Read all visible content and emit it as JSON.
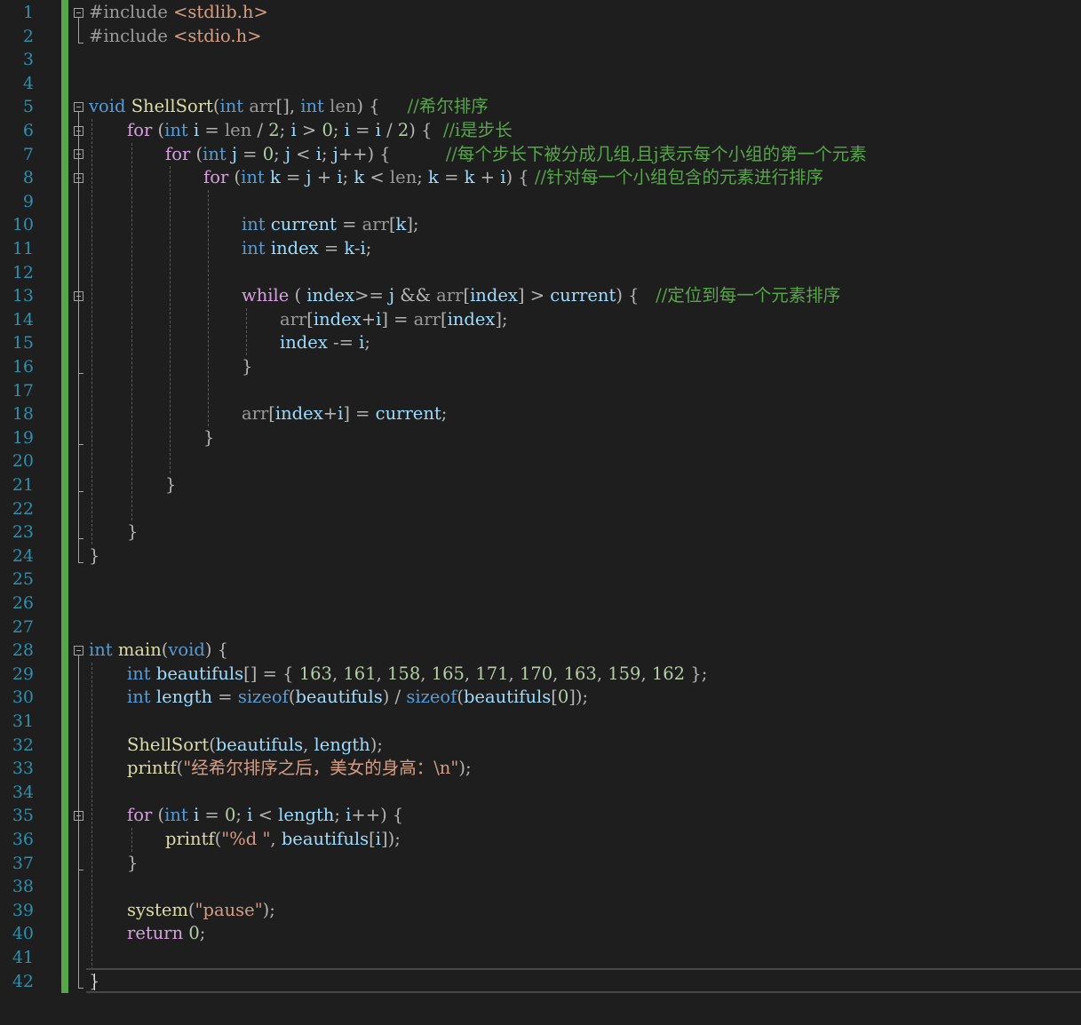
{
  "editor": {
    "line_count": 42,
    "current_line": 42
  },
  "lines": [
    {
      "n": 1,
      "indent": 0,
      "fold": true,
      "tokens": [
        [
          "pp",
          "#include "
        ],
        [
          "inc",
          "<stdlib.h>"
        ]
      ]
    },
    {
      "n": 2,
      "indent": 0,
      "tokens": [
        [
          "pp",
          "#include "
        ],
        [
          "inc",
          "<stdio.h>"
        ]
      ]
    },
    {
      "n": 3,
      "indent": 0,
      "tokens": []
    },
    {
      "n": 4,
      "indent": 0,
      "tokens": []
    },
    {
      "n": 5,
      "indent": 0,
      "fold": true,
      "tokens": [
        [
          "kw",
          "void"
        ],
        [
          "txt",
          " "
        ],
        [
          "fn",
          "ShellSort"
        ],
        [
          "punc",
          "("
        ],
        [
          "kw",
          "int"
        ],
        [
          "txt",
          " "
        ],
        [
          "param",
          "arr"
        ],
        [
          "punc",
          "[], "
        ],
        [
          "kw",
          "int"
        ],
        [
          "txt",
          " "
        ],
        [
          "param",
          "len"
        ],
        [
          "punc",
          ") {"
        ],
        [
          "txt",
          "     "
        ],
        [
          "cmt",
          "//希尔排序"
        ]
      ]
    },
    {
      "n": 6,
      "indent": 1,
      "fold": true,
      "tokens": [
        [
          "ctrl",
          "for"
        ],
        [
          "txt",
          " "
        ],
        [
          "punc",
          "("
        ],
        [
          "kw",
          "int"
        ],
        [
          "txt",
          " "
        ],
        [
          "var",
          "i"
        ],
        [
          "op",
          " = "
        ],
        [
          "param",
          "len"
        ],
        [
          "op",
          " / "
        ],
        [
          "num",
          "2"
        ],
        [
          "punc",
          "; "
        ],
        [
          "var",
          "i"
        ],
        [
          "op",
          " > "
        ],
        [
          "num",
          "0"
        ],
        [
          "punc",
          "; "
        ],
        [
          "var",
          "i"
        ],
        [
          "op",
          " = "
        ],
        [
          "var",
          "i"
        ],
        [
          "op",
          " / "
        ],
        [
          "num",
          "2"
        ],
        [
          "punc",
          ") {"
        ],
        [
          "txt",
          "  "
        ],
        [
          "cmt",
          "//i是步长"
        ]
      ]
    },
    {
      "n": 7,
      "indent": 2,
      "fold": true,
      "tokens": [
        [
          "ctrl",
          "for"
        ],
        [
          "txt",
          " "
        ],
        [
          "punc",
          "("
        ],
        [
          "kw",
          "int"
        ],
        [
          "txt",
          " "
        ],
        [
          "var",
          "j"
        ],
        [
          "op",
          " = "
        ],
        [
          "num",
          "0"
        ],
        [
          "punc",
          "; "
        ],
        [
          "var",
          "j"
        ],
        [
          "op",
          " < "
        ],
        [
          "var",
          "i"
        ],
        [
          "punc",
          "; "
        ],
        [
          "var",
          "j"
        ],
        [
          "op",
          "++"
        ],
        [
          "punc",
          ") {"
        ],
        [
          "txt",
          "          "
        ],
        [
          "cmt",
          "//每个步长下被分成几组,且j表示每个小组的第一个元素"
        ]
      ]
    },
    {
      "n": 8,
      "indent": 3,
      "fold": true,
      "tokens": [
        [
          "ctrl",
          "for"
        ],
        [
          "txt",
          " "
        ],
        [
          "punc",
          "("
        ],
        [
          "kw",
          "int"
        ],
        [
          "txt",
          " "
        ],
        [
          "var",
          "k"
        ],
        [
          "op",
          " = "
        ],
        [
          "var",
          "j"
        ],
        [
          "op",
          " + "
        ],
        [
          "var",
          "i"
        ],
        [
          "punc",
          "; "
        ],
        [
          "var",
          "k"
        ],
        [
          "op",
          " < "
        ],
        [
          "param",
          "len"
        ],
        [
          "punc",
          "; "
        ],
        [
          "var",
          "k"
        ],
        [
          "op",
          " = "
        ],
        [
          "var",
          "k"
        ],
        [
          "op",
          " + "
        ],
        [
          "var",
          "i"
        ],
        [
          "punc",
          ") { "
        ],
        [
          "cmt",
          "//针对每一个小组包含的元素进行排序"
        ]
      ]
    },
    {
      "n": 9,
      "indent": 0,
      "tokens": []
    },
    {
      "n": 10,
      "indent": 4,
      "tokens": [
        [
          "kw",
          "int"
        ],
        [
          "txt",
          " "
        ],
        [
          "var",
          "current"
        ],
        [
          "op",
          " = "
        ],
        [
          "param",
          "arr"
        ],
        [
          "punc",
          "["
        ],
        [
          "var",
          "k"
        ],
        [
          "punc",
          "];"
        ]
      ]
    },
    {
      "n": 11,
      "indent": 4,
      "tokens": [
        [
          "kw",
          "int"
        ],
        [
          "txt",
          " "
        ],
        [
          "var",
          "index"
        ],
        [
          "op",
          " = "
        ],
        [
          "var",
          "k"
        ],
        [
          "op",
          "-"
        ],
        [
          "var",
          "i"
        ],
        [
          "punc",
          ";"
        ]
      ]
    },
    {
      "n": 12,
      "indent": 0,
      "tokens": []
    },
    {
      "n": 13,
      "indent": 4,
      "fold": true,
      "tokens": [
        [
          "ctrl",
          "while"
        ],
        [
          "txt",
          " "
        ],
        [
          "punc",
          "( "
        ],
        [
          "var",
          "index"
        ],
        [
          "op",
          ">= "
        ],
        [
          "var",
          "j"
        ],
        [
          "op",
          " && "
        ],
        [
          "param",
          "arr"
        ],
        [
          "punc",
          "["
        ],
        [
          "var",
          "index"
        ],
        [
          "punc",
          "]"
        ],
        [
          "op",
          " > "
        ],
        [
          "var",
          "current"
        ],
        [
          "punc",
          ") {"
        ],
        [
          "txt",
          "   "
        ],
        [
          "cmt",
          "//定位到每一个元素排序"
        ]
      ]
    },
    {
      "n": 14,
      "indent": 5,
      "tokens": [
        [
          "param",
          "arr"
        ],
        [
          "punc",
          "["
        ],
        [
          "var",
          "index"
        ],
        [
          "op",
          "+"
        ],
        [
          "var",
          "i"
        ],
        [
          "punc",
          "]"
        ],
        [
          "op",
          " = "
        ],
        [
          "param",
          "arr"
        ],
        [
          "punc",
          "["
        ],
        [
          "var",
          "index"
        ],
        [
          "punc",
          "];"
        ]
      ]
    },
    {
      "n": 15,
      "indent": 5,
      "tokens": [
        [
          "var",
          "index"
        ],
        [
          "op",
          " -= "
        ],
        [
          "var",
          "i"
        ],
        [
          "punc",
          ";"
        ]
      ]
    },
    {
      "n": 16,
      "indent": 4,
      "tokens": [
        [
          "punc",
          "}"
        ]
      ]
    },
    {
      "n": 17,
      "indent": 0,
      "tokens": []
    },
    {
      "n": 18,
      "indent": 4,
      "tokens": [
        [
          "param",
          "arr"
        ],
        [
          "punc",
          "["
        ],
        [
          "var",
          "index"
        ],
        [
          "op",
          "+"
        ],
        [
          "var",
          "i"
        ],
        [
          "punc",
          "]"
        ],
        [
          "op",
          " = "
        ],
        [
          "var",
          "current"
        ],
        [
          "punc",
          ";"
        ]
      ]
    },
    {
      "n": 19,
      "indent": 3,
      "tokens": [
        [
          "punc",
          "}"
        ]
      ]
    },
    {
      "n": 20,
      "indent": 0,
      "tokens": []
    },
    {
      "n": 21,
      "indent": 2,
      "tokens": [
        [
          "punc",
          "}"
        ]
      ]
    },
    {
      "n": 22,
      "indent": 0,
      "tokens": []
    },
    {
      "n": 23,
      "indent": 1,
      "tokens": [
        [
          "punc",
          "}"
        ]
      ]
    },
    {
      "n": 24,
      "indent": 0,
      "tokens": [
        [
          "punc",
          "}"
        ]
      ]
    },
    {
      "n": 25,
      "indent": 0,
      "tokens": []
    },
    {
      "n": 26,
      "indent": 0,
      "tokens": []
    },
    {
      "n": 27,
      "indent": 0,
      "tokens": []
    },
    {
      "n": 28,
      "indent": 0,
      "fold": true,
      "tokens": [
        [
          "kw",
          "int"
        ],
        [
          "txt",
          " "
        ],
        [
          "fn",
          "main"
        ],
        [
          "punc",
          "("
        ],
        [
          "kw",
          "void"
        ],
        [
          "punc",
          ") {"
        ]
      ]
    },
    {
      "n": 29,
      "indent": 1,
      "tokens": [
        [
          "kw",
          "int"
        ],
        [
          "txt",
          " "
        ],
        [
          "var",
          "beautifuls"
        ],
        [
          "punc",
          "[]"
        ],
        [
          "op",
          " = "
        ],
        [
          "punc",
          "{ "
        ],
        [
          "num",
          "163"
        ],
        [
          "punc",
          ", "
        ],
        [
          "num",
          "161"
        ],
        [
          "punc",
          ", "
        ],
        [
          "num",
          "158"
        ],
        [
          "punc",
          ", "
        ],
        [
          "num",
          "165"
        ],
        [
          "punc",
          ", "
        ],
        [
          "num",
          "171"
        ],
        [
          "punc",
          ", "
        ],
        [
          "num",
          "170"
        ],
        [
          "punc",
          ", "
        ],
        [
          "num",
          "163"
        ],
        [
          "punc",
          ", "
        ],
        [
          "num",
          "159"
        ],
        [
          "punc",
          ", "
        ],
        [
          "num",
          "162"
        ],
        [
          "punc",
          " };"
        ]
      ]
    },
    {
      "n": 30,
      "indent": 1,
      "tokens": [
        [
          "kw",
          "int"
        ],
        [
          "txt",
          " "
        ],
        [
          "var",
          "length"
        ],
        [
          "op",
          " = "
        ],
        [
          "kw",
          "sizeof"
        ],
        [
          "punc",
          "("
        ],
        [
          "var",
          "beautifuls"
        ],
        [
          "punc",
          ")"
        ],
        [
          "op",
          " / "
        ],
        [
          "kw",
          "sizeof"
        ],
        [
          "punc",
          "("
        ],
        [
          "var",
          "beautifuls"
        ],
        [
          "punc",
          "["
        ],
        [
          "num",
          "0"
        ],
        [
          "punc",
          "]);"
        ]
      ]
    },
    {
      "n": 31,
      "indent": 0,
      "tokens": []
    },
    {
      "n": 32,
      "indent": 1,
      "tokens": [
        [
          "fn",
          "ShellSort"
        ],
        [
          "punc",
          "("
        ],
        [
          "var",
          "beautifuls"
        ],
        [
          "punc",
          ", "
        ],
        [
          "var",
          "length"
        ],
        [
          "punc",
          ");"
        ]
      ]
    },
    {
      "n": 33,
      "indent": 1,
      "tokens": [
        [
          "fn",
          "printf"
        ],
        [
          "punc",
          "("
        ],
        [
          "str",
          "\"经希尔排序之后，美女的身高：\\n\""
        ],
        [
          "punc",
          ");"
        ]
      ]
    },
    {
      "n": 34,
      "indent": 0,
      "tokens": []
    },
    {
      "n": 35,
      "indent": 1,
      "fold": true,
      "tokens": [
        [
          "ctrl",
          "for"
        ],
        [
          "txt",
          " "
        ],
        [
          "punc",
          "("
        ],
        [
          "kw",
          "int"
        ],
        [
          "txt",
          " "
        ],
        [
          "var",
          "i"
        ],
        [
          "op",
          " = "
        ],
        [
          "num",
          "0"
        ],
        [
          "punc",
          "; "
        ],
        [
          "var",
          "i"
        ],
        [
          "op",
          " < "
        ],
        [
          "var",
          "length"
        ],
        [
          "punc",
          "; "
        ],
        [
          "var",
          "i"
        ],
        [
          "op",
          "++"
        ],
        [
          "punc",
          ") {"
        ]
      ]
    },
    {
      "n": 36,
      "indent": 2,
      "tokens": [
        [
          "fn",
          "printf"
        ],
        [
          "punc",
          "("
        ],
        [
          "str",
          "\"%d \""
        ],
        [
          "punc",
          ", "
        ],
        [
          "var",
          "beautifuls"
        ],
        [
          "punc",
          "["
        ],
        [
          "var",
          "i"
        ],
        [
          "punc",
          "]);"
        ]
      ]
    },
    {
      "n": 37,
      "indent": 1,
      "tokens": [
        [
          "punc",
          "}"
        ]
      ]
    },
    {
      "n": 38,
      "indent": 0,
      "tokens": []
    },
    {
      "n": 39,
      "indent": 1,
      "tokens": [
        [
          "fn",
          "system"
        ],
        [
          "punc",
          "("
        ],
        [
          "str",
          "\"pause\""
        ],
        [
          "punc",
          ");"
        ]
      ]
    },
    {
      "n": 40,
      "indent": 1,
      "tokens": [
        [
          "ctrl",
          "return"
        ],
        [
          "txt",
          " "
        ],
        [
          "num",
          "0"
        ],
        [
          "punc",
          ";"
        ]
      ]
    },
    {
      "n": 41,
      "indent": 0,
      "tokens": []
    },
    {
      "n": 42,
      "indent": 0,
      "tokens": [
        [
          "punc",
          "}"
        ]
      ]
    }
  ]
}
